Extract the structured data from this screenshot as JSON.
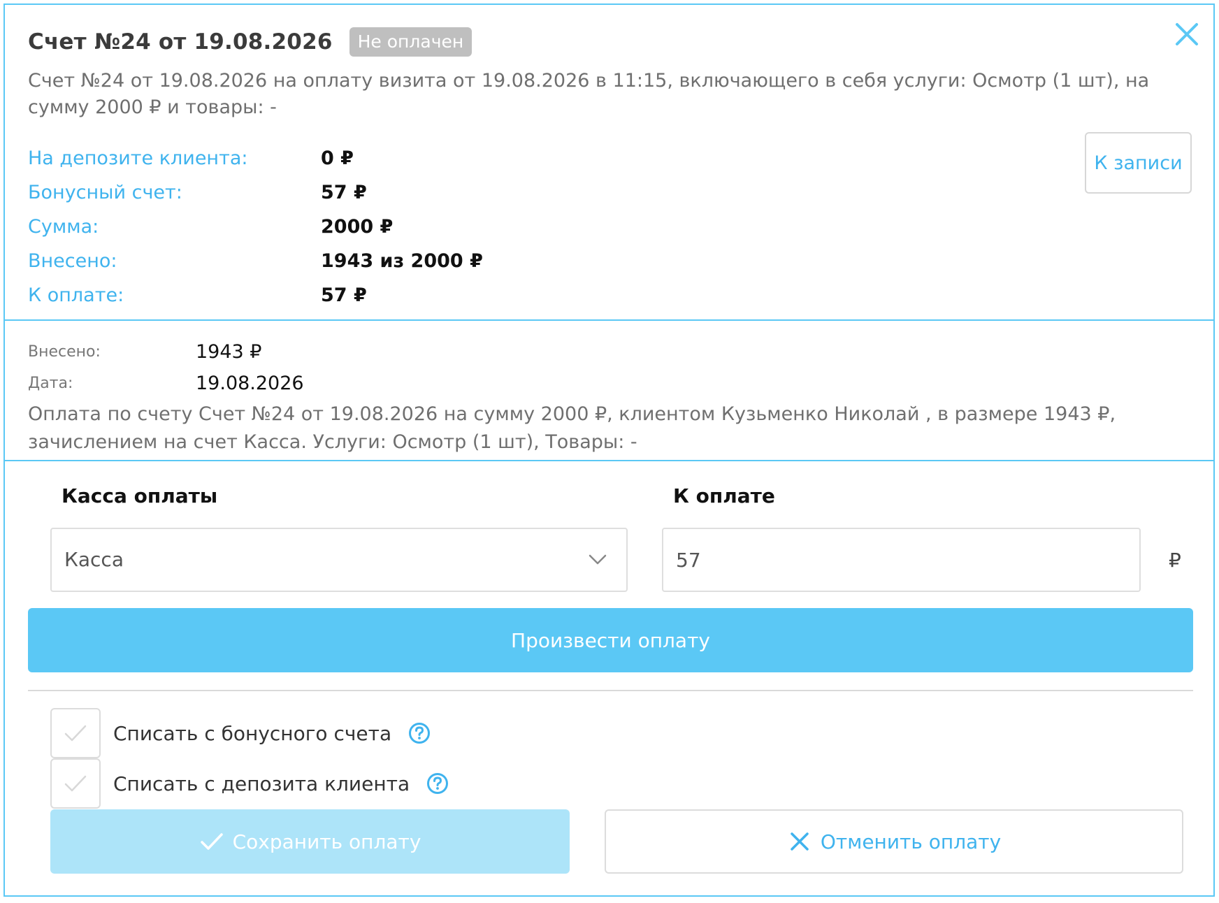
{
  "modal": {
    "title": "Счет №24 от 19.08.2026",
    "status_badge": "Не оплачен",
    "description": "Счет №24 от 19.08.2026 на оплату визита от 19.08.2026 в 11:15, включающего в себя услуги: Осмотр (1 шт), на сумму 2000 ₽ и товары: -",
    "to_record_label": "К записи"
  },
  "summary": {
    "items": [
      {
        "label": "На депозите клиента:",
        "value": "0 ₽"
      },
      {
        "label": "Бонусный счет:",
        "value": "57 ₽"
      },
      {
        "label": "Сумма:",
        "value": "2000 ₽"
      },
      {
        "label": "Внесено:",
        "value": "1943 из 2000 ₽"
      },
      {
        "label": "К оплате:",
        "value": "57 ₽"
      }
    ]
  },
  "payment_record": {
    "paid_label": "Внесено:",
    "paid_value": "1943 ₽",
    "date_label": "Дата:",
    "date_value": "19.08.2026",
    "description": "Оплата по счету Счет №24 от 19.08.2026 на сумму 2000 ₽, клиентом Кузьменко Николай , в размере 1943 ₽, зачислением на счет Касса. Услуги: Осмотр (1 шт), Товары: -"
  },
  "payment_form": {
    "cashbox_label": "Касса оплаты",
    "cashbox_value": "Касса",
    "amount_label": "К оплате",
    "amount_value": "57",
    "currency": "₽",
    "pay_button": "Произвести оплату",
    "bonus_checkbox": "Списать с бонусного счета",
    "deposit_checkbox": "Списать с депозита клиента",
    "save_button": "Сохранить оплату",
    "cancel_button": "Отменить оплату"
  },
  "colors": {
    "accent": "#5bc8f5",
    "link": "#3fb3ee",
    "badge": "#bfbfbf",
    "save_disabled": "#ade4f9"
  },
  "icons": [
    "close-icon",
    "chevron-down-icon",
    "check-icon",
    "help-icon",
    "x-icon"
  ]
}
